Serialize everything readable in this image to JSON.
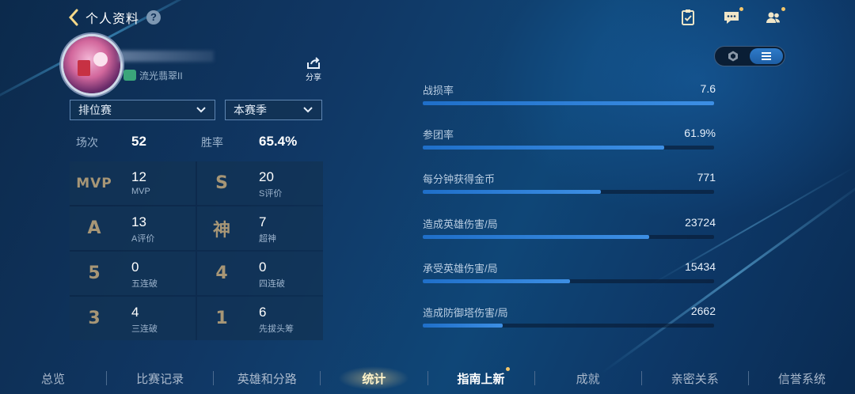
{
  "header": {
    "title": "个人资料",
    "help": "?"
  },
  "profile": {
    "rank_text": "流光翡翠II",
    "share_label": "分享"
  },
  "filters": {
    "mode": "排位赛",
    "season": "本赛季"
  },
  "summary": {
    "games_label": "场次",
    "games_value": "52",
    "winrate_label": "胜率",
    "winrate_value": "65.4%"
  },
  "achievements": [
    {
      "glyph": "MVP",
      "value": "12",
      "label": "MVP"
    },
    {
      "glyph": "S",
      "value": "20",
      "label": "S评价"
    },
    {
      "glyph": "A",
      "value": "13",
      "label": "A评价"
    },
    {
      "glyph": "神",
      "value": "7",
      "label": "超神"
    },
    {
      "glyph": "5",
      "value": "0",
      "label": "五连破"
    },
    {
      "glyph": "4",
      "value": "0",
      "label": "四连破"
    },
    {
      "glyph": "3",
      "value": "4",
      "label": "三连破"
    },
    {
      "glyph": "1",
      "value": "6",
      "label": "先拔头筹"
    }
  ],
  "stats": [
    {
      "name": "战损率",
      "value": "7.6",
      "fill": 1.0
    },
    {
      "name": "参团率",
      "value": "61.9%",
      "fill": 0.828
    },
    {
      "name": "每分钟获得金币",
      "value": "771",
      "fill": 0.612
    },
    {
      "name": "造成英雄伤害/局",
      "value": "23724",
      "fill": 0.777
    },
    {
      "name": "承受英雄伤害/局",
      "value": "15434",
      "fill": 0.506
    },
    {
      "name": "造成防御塔伤害/局",
      "value": "2662",
      "fill": 0.274
    }
  ],
  "nav": [
    {
      "label": "总览"
    },
    {
      "label": "比赛记录"
    },
    {
      "label": "英雄和分路"
    },
    {
      "label": "统计",
      "active": true
    },
    {
      "label": "指南上新",
      "dot": true
    },
    {
      "label": "成就"
    },
    {
      "label": "亲密关系"
    },
    {
      "label": "信誉系统"
    }
  ],
  "icons": {
    "back": "chevron-left-icon",
    "tasks": "clipboard-check-icon",
    "chat": "chat-bubble-icon",
    "friends": "friends-icon",
    "share": "share-icon",
    "view_radar": "hexagon-icon",
    "view_list": "list-icon"
  },
  "colors": {
    "accent": "#3d8fe4",
    "glyph": "#a79676",
    "active_tab": "#fff3c9"
  }
}
